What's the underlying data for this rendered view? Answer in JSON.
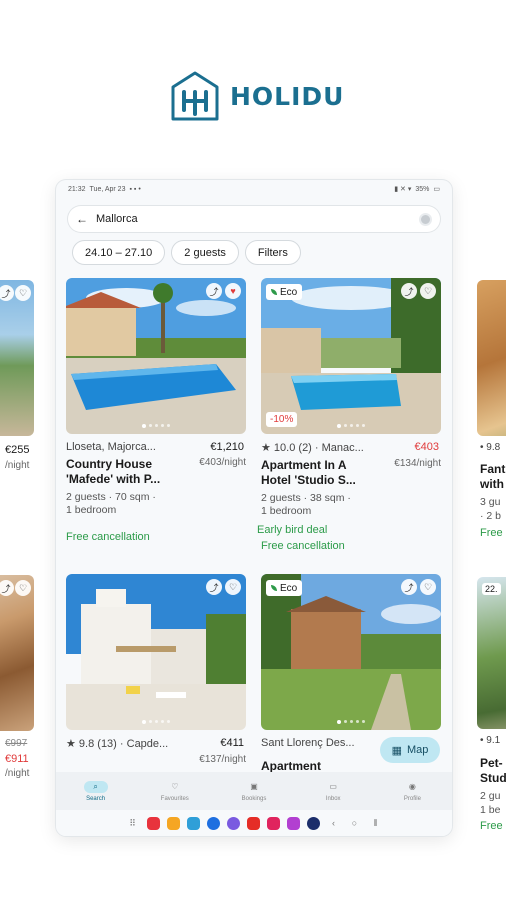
{
  "brand": {
    "name": "HOLIDU",
    "color": "#1b6f90"
  },
  "status_bar": {
    "time": "21:32",
    "date": "Tue, Apr 23",
    "battery": "35%"
  },
  "search": {
    "query": "Mallorca"
  },
  "filters": [
    {
      "label": "24.10 – 27.10"
    },
    {
      "label": "2 guests"
    },
    {
      "label": "Filters"
    }
  ],
  "listings": [
    {
      "location": "Lloseta, Majorca...",
      "price": "€1,210",
      "per_night": "€403/night",
      "title": "Country House 'Mafede' with P...",
      "details": "2 guests · 70 sqm ·",
      "details2": "1 bedroom",
      "tags": [
        "Free cancellation"
      ]
    },
    {
      "badge": "Eco",
      "discount": "-10%",
      "rating": "10.0",
      "reviews": "(2)",
      "location": "Manac...",
      "price": "€403",
      "per_night": "€134/night",
      "title": "Apartment In A Hotel 'Studio S...",
      "details": "2 guests · 38 sqm ·",
      "details2": "1 bedroom",
      "tags": [
        "Early bird deal",
        "Free cancellation"
      ]
    },
    {
      "rating": "9.8",
      "reviews": "(13)",
      "location": "Capde...",
      "price": "€411",
      "per_night": "€137/night"
    },
    {
      "badge": "Eco",
      "location": "Sant Llorenç Des...",
      "title": "Apartment"
    }
  ],
  "side_peeks": {
    "left_top_price": "€255",
    "left_top_per": "/night",
    "left_bot_old": "€997",
    "left_bot_price": "€911",
    "left_bot_per": "/night",
    "right_top_rating": "9.8",
    "right_top_title1": "Fant",
    "right_top_title2": "with",
    "right_top_d1": "3 gu",
    "right_top_d2": "· 2 b",
    "right_top_green": "Free",
    "right_bot_badge": "22.",
    "right_bot_rating": "9.1",
    "right_bot_title1": "Pet-",
    "right_bot_title2": "Stud",
    "right_bot_d1": "2 gu",
    "right_bot_d2": "1 be",
    "right_bot_green": "Free"
  },
  "map_button": {
    "label": "Map"
  },
  "bottom_nav": [
    {
      "label": "Search",
      "icon": "search-icon",
      "active": true
    },
    {
      "label": "Favourites",
      "icon": "heart-icon"
    },
    {
      "label": "Bookings",
      "icon": "suitcase-icon"
    },
    {
      "label": "Inbox",
      "icon": "chat-icon"
    },
    {
      "label": "Profile",
      "icon": "profile-icon"
    }
  ],
  "colors": {
    "accent": "#bfe7f2",
    "green": "#2c9b49",
    "red": "#e03b3b"
  }
}
